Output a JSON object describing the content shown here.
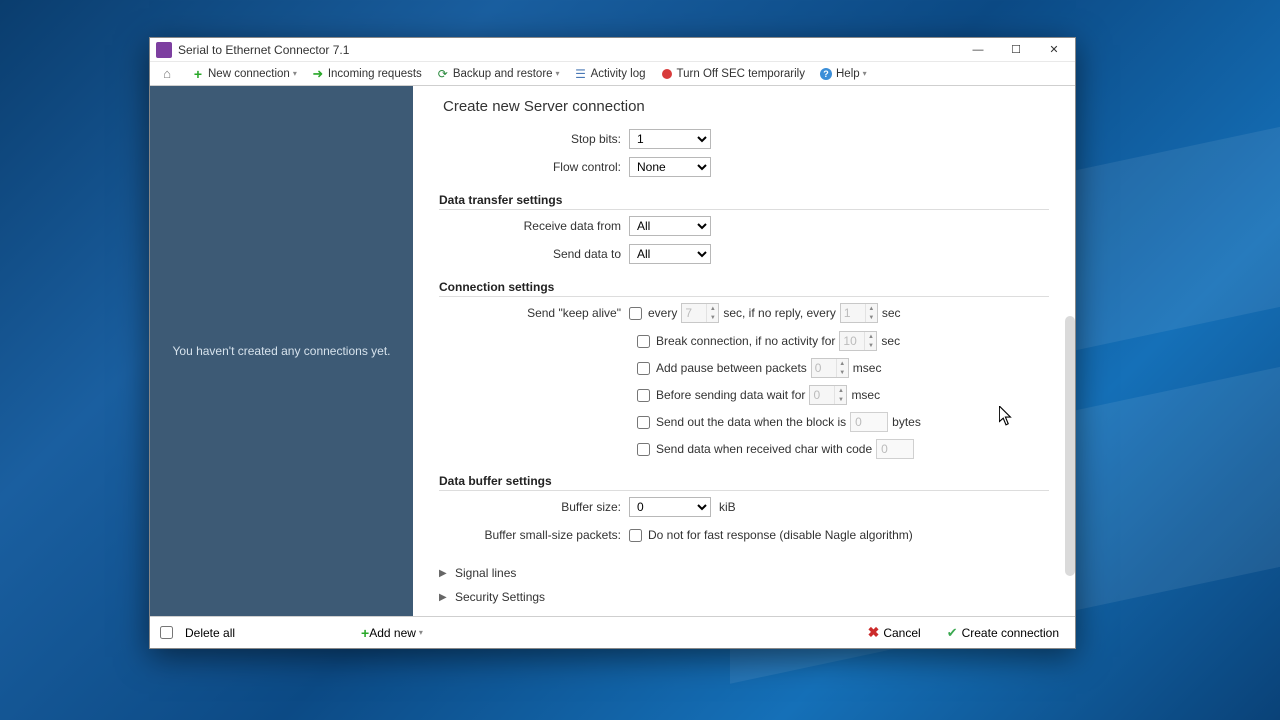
{
  "title": "Serial to Ethernet Connector 7.1",
  "toolbar": {
    "new_connection": "New connection",
    "incoming_requests": "Incoming requests",
    "backup_restore": "Backup and restore",
    "activity_log": "Activity log",
    "turn_off": "Turn Off SEC temporarily",
    "help": "Help"
  },
  "sidebar": {
    "empty_msg": "You haven't created any connections yet."
  },
  "header": "Create new Server connection",
  "serial": {
    "stop_bits_label": "Stop bits:",
    "stop_bits_value": "1",
    "flow_label": "Flow control:",
    "flow_value": "None"
  },
  "sections": {
    "data_transfer": "Data transfer settings",
    "connection": "Connection settings",
    "buffer": "Data buffer settings"
  },
  "transfer": {
    "receive_label": "Receive data from",
    "receive_value": "All",
    "send_label": "Send data to",
    "send_value": "All"
  },
  "conn": {
    "keepalive_label": "Send \"keep alive\"",
    "every": "every",
    "keepalive_val1": "7",
    "sec_if_no_reply": "sec, if no reply, every",
    "keepalive_val2": "1",
    "sec": "sec",
    "break_label": "Break connection, if no activity for",
    "break_val": "10",
    "pause_label": "Add pause between packets",
    "pause_val": "0",
    "msec": "msec",
    "before_label": "Before sending data wait for",
    "before_val": "0",
    "block_label": "Send out the data when the block is",
    "block_val": "0",
    "bytes": "bytes",
    "char_label": "Send data when received char with code",
    "char_val": "0"
  },
  "buffer": {
    "size_label": "Buffer size:",
    "size_value": "0",
    "kib": "kiB",
    "small_label": "Buffer small-size packets:",
    "nagle_label": "Do not for fast response (disable Nagle algorithm)"
  },
  "expanders": {
    "signal": "Signal lines",
    "security": "Security Settings"
  },
  "footer": {
    "delete_all": "Delete all",
    "add_new": "Add new",
    "cancel": "Cancel",
    "create": "Create connection"
  }
}
